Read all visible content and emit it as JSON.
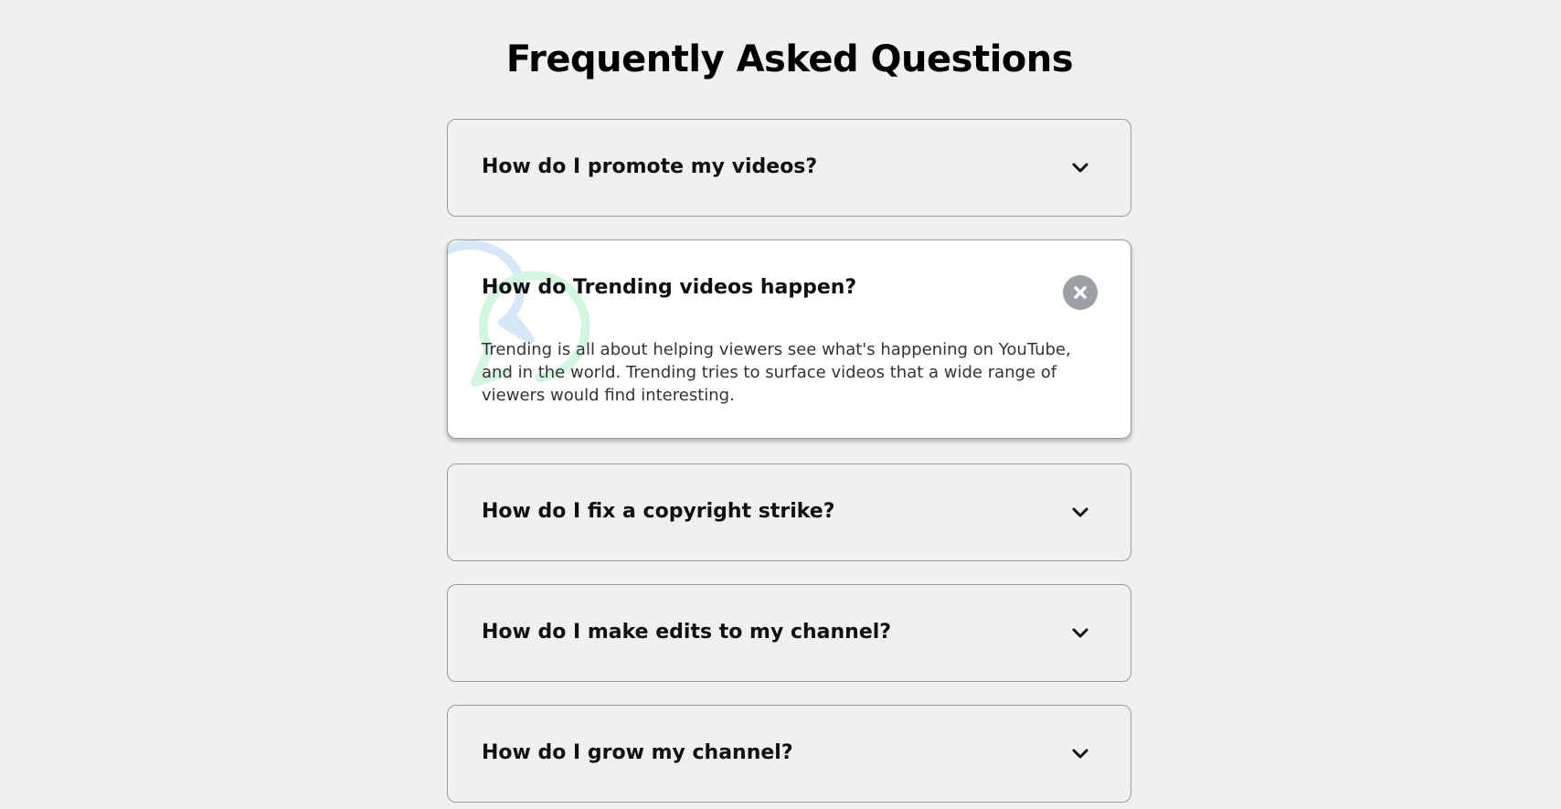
{
  "heading": "Frequently Asked Questions",
  "faqs": [
    {
      "question": "How do I promote my videos?",
      "toggle_icon": "chevron-down-icon"
    },
    {
      "question": "How do Trending videos happen?",
      "answer": "Trending is all about helping viewers see what's happening on YouTube, and in the world. Trending tries to surface videos that a wide range of viewers would find interesting.",
      "toggle_icon": "close-icon"
    },
    {
      "question": "How do I fix a copyright strike?",
      "toggle_icon": "chevron-down-icon"
    },
    {
      "question": "How do I make edits to my channel?",
      "toggle_icon": "chevron-down-icon"
    },
    {
      "question": "How do I grow my channel?",
      "toggle_icon": "chevron-down-icon"
    }
  ],
  "colors": {
    "page_background": "#f0f0f0",
    "active_card_background": "#ffffff",
    "card_border": "#9b9b9b",
    "close_button": "#9aa0a4",
    "bubble_blue": "#d6e8f8",
    "bubble_green": "#d4f5df"
  }
}
